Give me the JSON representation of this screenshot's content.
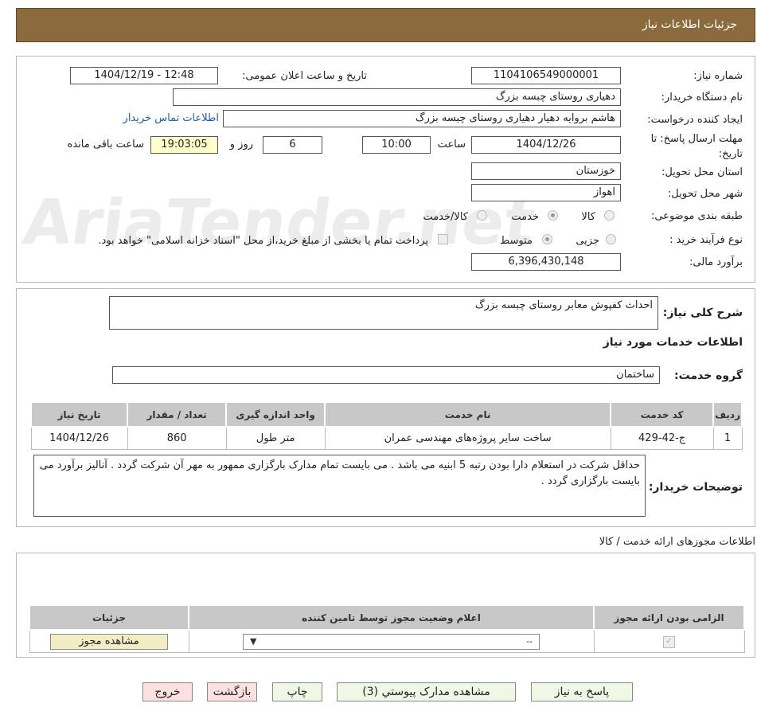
{
  "header": {
    "title": "جزئیات اطلاعات نیاز"
  },
  "form": {
    "need_number_label": "شماره نیاز:",
    "need_number": "1104106549000001",
    "announce_label": "تاریخ و ساعت اعلان عمومی:",
    "announce_value": "1404/12/19 - 12:48",
    "buyer_org_label": "نام دستگاه خریدار:",
    "buyer_org": "دهیاری روستای چبسه بزرگ",
    "creator_label": "ایجاد کننده درخواست:",
    "creator": "هاشم بروایه دهیار دهیاری روستای چبسه بزرگ",
    "contact_link": "اطلاعات تماس خریدار",
    "deadline_label_1": "مهلت ارسال پاسخ: تا",
    "deadline_label_2": "تاریخ:",
    "deadline_date": "1404/12/26",
    "time_label": "ساعت",
    "deadline_time": "10:00",
    "days": "6",
    "days_label": "روز و",
    "remaining": "19:03:05",
    "remaining_label": "ساعت باقی مانده",
    "province_label": "استان محل تحویل:",
    "province": "خوزستان",
    "city_label": "شهر محل تحویل:",
    "city": "اهواز",
    "category_label": "طبقه بندی موضوعی:",
    "category_options": [
      "کالا",
      "خدمت",
      "کالا/خدمت"
    ],
    "category_selected": "خدمت",
    "process_label": "نوع فرآیند خرید :",
    "process_options": [
      "جزیی",
      "متوسط"
    ],
    "process_selected": "متوسط",
    "payment_note": "پرداخت تمام یا بخشی از مبلغ خرید،از محل \"اسناد خزانه اسلامی\" خواهد بود.",
    "budget_label": "برآورد مالی:",
    "budget": "6,396,430,148"
  },
  "summary": {
    "label": "شرح کلی نیاز:",
    "text": "احداث کفپوش معابر روستای چبسه بزرگ",
    "services_title": "اطلاعات خدمات مورد نیاز",
    "group_label": "گروه خدمت:",
    "group_value": "ساختمان"
  },
  "services_table": {
    "headers": [
      "ردیف",
      "کد خدمت",
      "نام خدمت",
      "واحد اندازه گیری",
      "تعداد / مقدار",
      "تاریخ نیاز"
    ],
    "rows": [
      [
        "1",
        "ج-42-429",
        "ساخت سایر پروژه‌های مهندسی عمران",
        "متر طول",
        "860",
        "1404/12/26"
      ]
    ]
  },
  "buyer_notes": {
    "label": "توضیحات خریدار:",
    "text": "حداقل شرکت در استعلام دارا بودن رتبه 5 ابنیه می باشد . می بایست تمام مدارک بارگزاری ممهور به مهر آن شرکت گردد . آنالیز برآورد می بایست بارگزاری گردد ."
  },
  "permits": {
    "title": "اطلاعات مجوزهای ارائه خدمت / کالا",
    "headers": [
      "الزامی بودن ارائه مجوز",
      "اعلام وضعیت مجوز توسط تامین کننده",
      "جزئیات"
    ],
    "select_value": "--",
    "view_button": "مشاهده مجوز"
  },
  "footer": {
    "reply": "پاسخ به نیاز",
    "attachments": "مشاهده مدارک پیوستي (3)",
    "print": "چاپ",
    "back": "بازگشت",
    "exit": "خروج"
  },
  "watermark": "AriaTender.net"
}
